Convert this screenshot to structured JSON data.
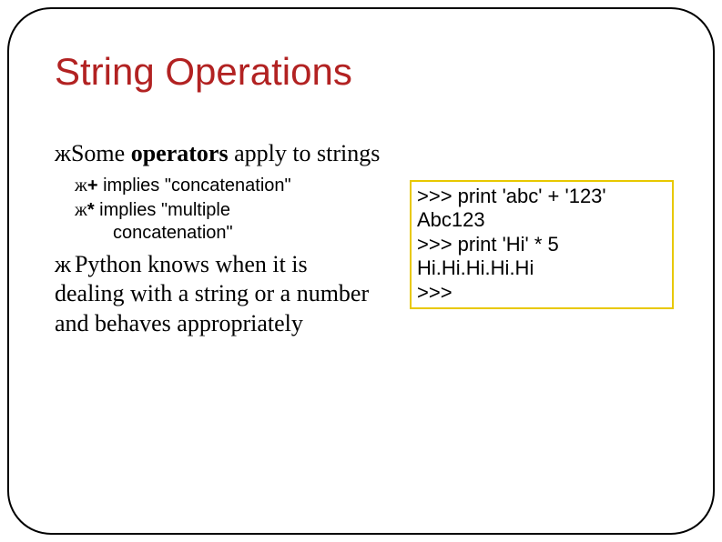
{
  "title": "String Operations",
  "bullets": {
    "main1_prefix": "Some ",
    "main1_bold": "operators",
    "main1_suffix": " apply to strings",
    "sub1_prefix": "+",
    "sub1_text": " implies \"concatenation\"",
    "sub2_prefix": "*",
    "sub2_text": " implies \"multiple",
    "sub2_text_line2": "concatenation\"",
    "main2": "Python knows when it is dealing with a string or a number and behaves appropriately"
  },
  "code": ">>> print 'abc' + '123'\nAbc123\n>>> print 'Hi' * 5\nHi.Hi.Hi.Hi.Hi\n>>>",
  "marker": "ж"
}
